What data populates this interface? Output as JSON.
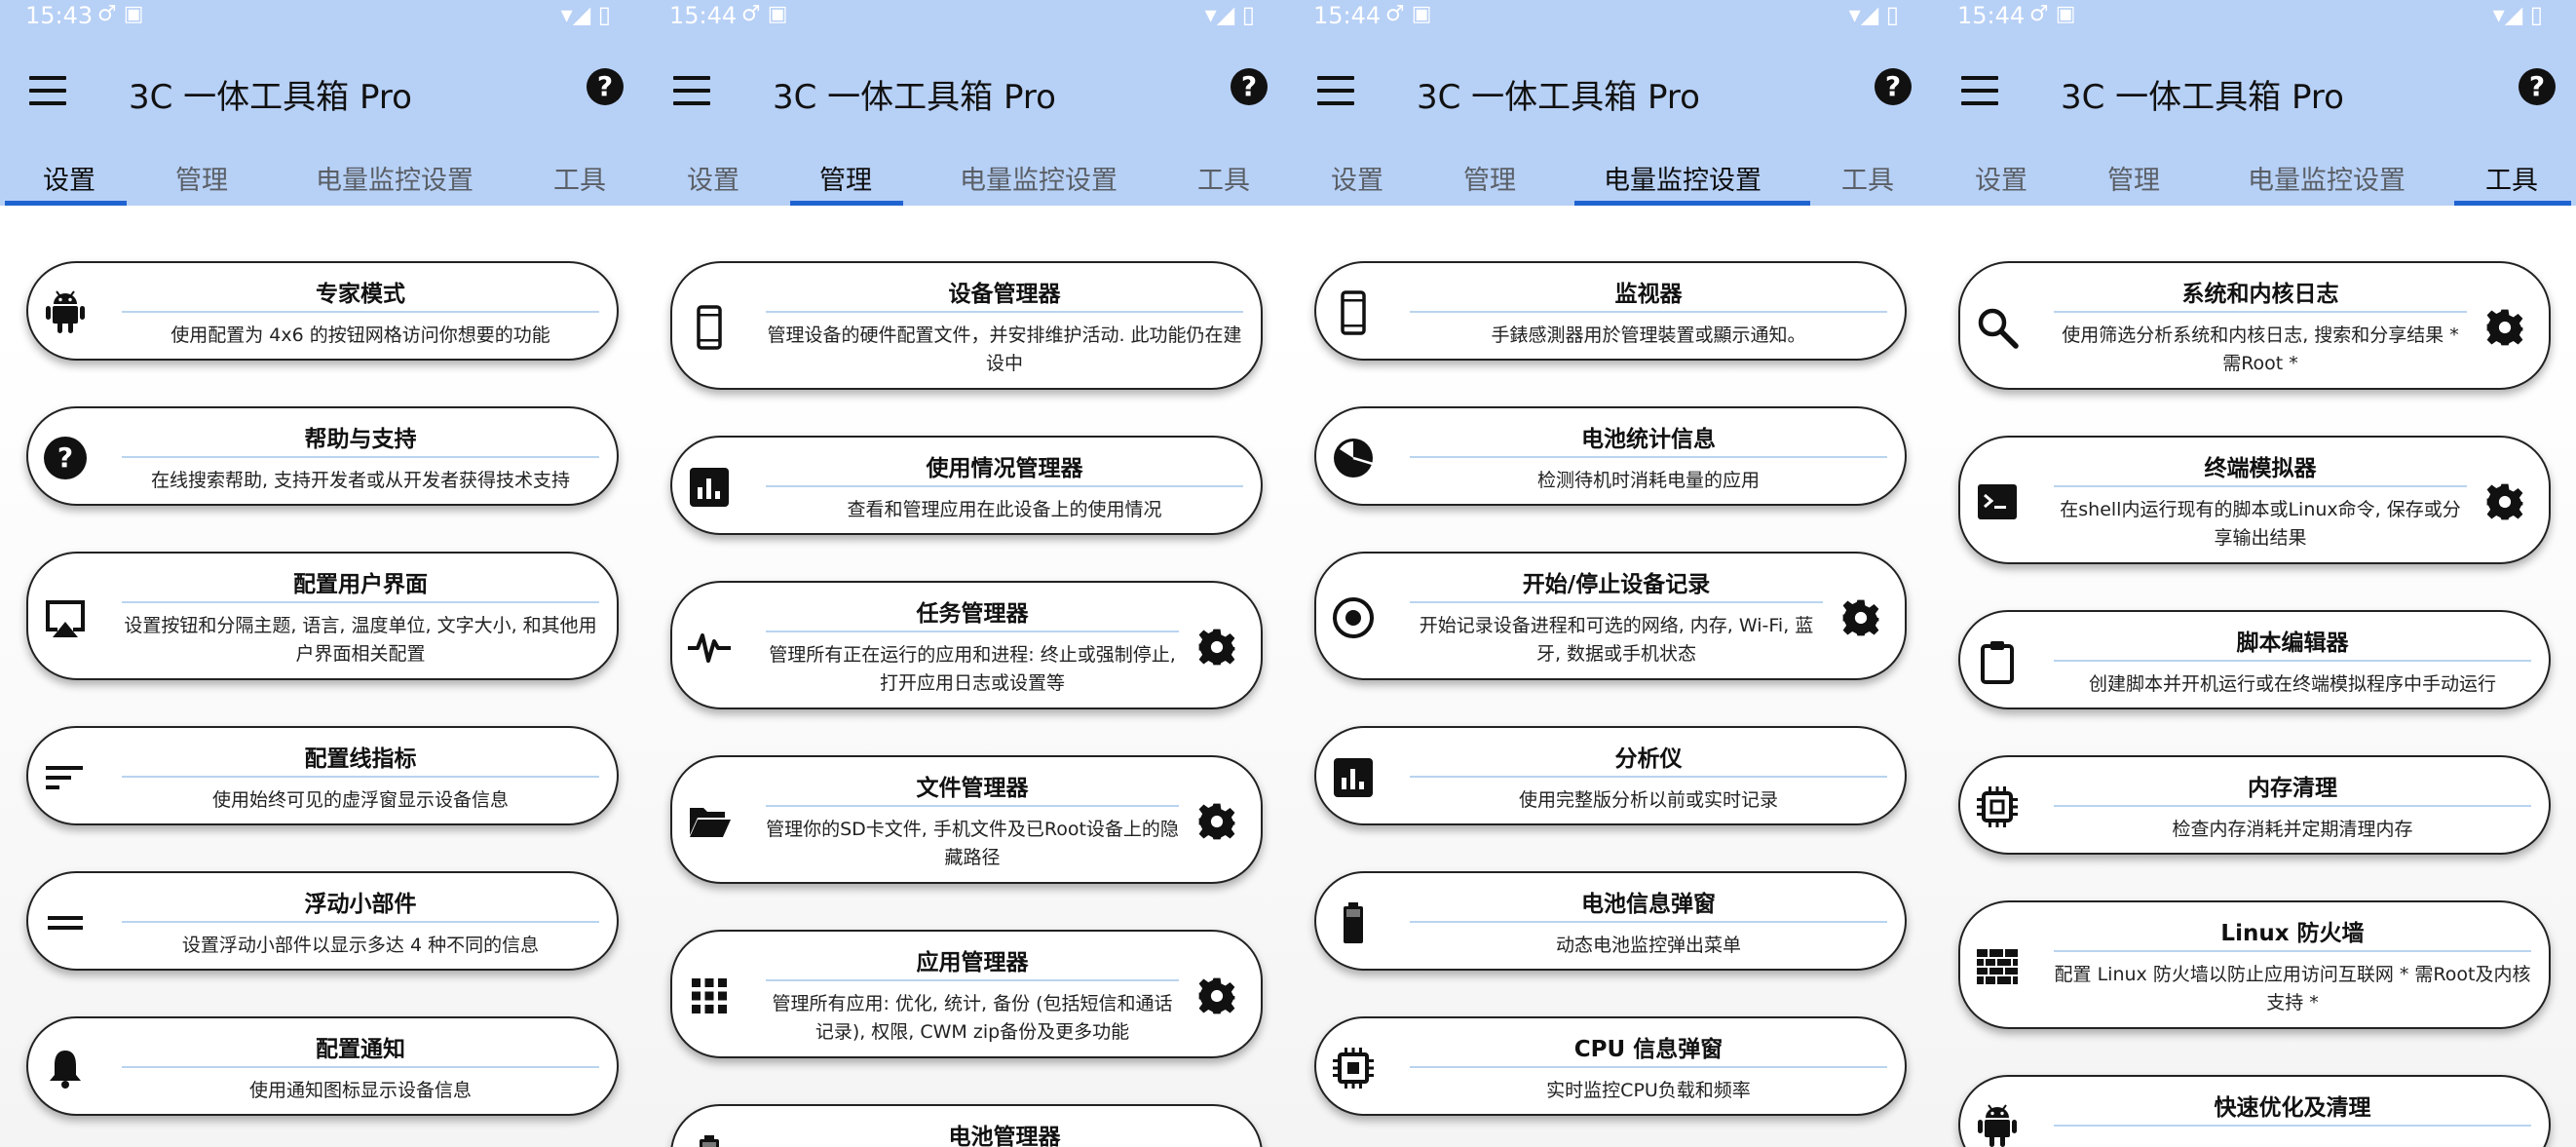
{
  "screens": [
    {
      "status": {
        "time": "15:43",
        "left_icons": "♂ ▣",
        "right_icons": "▾◢ ▯"
      },
      "title": "3C 一体工具箱 Pro",
      "tabs": [
        {
          "label": "设置"
        },
        {
          "label": "管理"
        },
        {
          "label": "电量监控设置"
        },
        {
          "label": "工具"
        }
      ],
      "active_tab": 0,
      "cards": [
        {
          "title": "专家模式",
          "desc": "使用配置为 4x6 的按钮网格访问你想要的功能",
          "icon": "android-icon",
          "gear": false
        },
        {
          "title": "帮助与支持",
          "desc": "在线搜索帮助, 支持开发者或从开发者获得技术支持",
          "icon": "help-circle-icon",
          "gear": false
        },
        {
          "title": "配置用户界面",
          "desc": "设置按钮和分隔主题, 语言, 温度单位, 文字大小, 和其他用户界面相关配置",
          "icon": "cast-screen-icon",
          "gear": false
        },
        {
          "title": "配置线指标",
          "desc": "使用始终可见的虚浮窗显示设备信息",
          "icon": "short-lines-icon",
          "gear": false
        },
        {
          "title": "浮动小部件",
          "desc": "设置浮动小部件以显示多达 4 种不同的信息",
          "icon": "equals-icon",
          "gear": false
        },
        {
          "title": "配置通知",
          "desc": "使用通知图标显示设备信息",
          "icon": "bell-icon",
          "gear": false
        }
      ]
    },
    {
      "status": {
        "time": "15:44",
        "left_icons": "♂ ▣",
        "right_icons": "▾◢ ▯"
      },
      "title": "3C 一体工具箱 Pro",
      "tabs": [
        {
          "label": "设置"
        },
        {
          "label": "管理"
        },
        {
          "label": "电量监控设置"
        },
        {
          "label": "工具"
        }
      ],
      "active_tab": 1,
      "cards": [
        {
          "title": "设备管理器",
          "desc": "管理设备的硬件配置文件，并安排维护活动. 此功能仍在建设中",
          "icon": "phone-icon",
          "gear": false
        },
        {
          "title": "使用情况管理器",
          "desc": "查看和管理应用在此设备上的使用情况",
          "icon": "bar-chart-icon",
          "gear": false
        },
        {
          "title": "任务管理器",
          "desc": "管理所有正在运行的应用和进程: 终止或强制停止, 打开应用日志或设置等",
          "icon": "pulse-icon",
          "gear": true
        },
        {
          "title": "文件管理器",
          "desc": "管理你的SD卡文件, 手机文件及已Root设备上的隐藏路径",
          "icon": "folder-open-icon",
          "gear": true
        },
        {
          "title": "应用管理器",
          "desc": "管理所有应用: 优化, 统计, 备份 (包括短信和通话记录), 权限, CWM zip备份及更多功能",
          "icon": "apps-grid-icon",
          "gear": true
        },
        {
          "title": "电池管理器",
          "desc": "",
          "icon": "battery-icon",
          "gear": false
        }
      ]
    },
    {
      "status": {
        "time": "15:44",
        "left_icons": "♂ ▣",
        "right_icons": "▾◢ ▯"
      },
      "title": "3C 一体工具箱 Pro",
      "tabs": [
        {
          "label": "设置"
        },
        {
          "label": "管理"
        },
        {
          "label": "电量监控设置"
        },
        {
          "label": "工具"
        }
      ],
      "active_tab": 2,
      "cards": [
        {
          "title": "监视器",
          "desc": "手錶感測器用於管理裝置或顯示通知。",
          "icon": "phone-icon",
          "gear": false
        },
        {
          "title": "电池统计信息",
          "desc": "检测待机时消耗电量的应用",
          "icon": "pie-chart-icon",
          "gear": false
        },
        {
          "title": "开始/停止设备记录",
          "desc": "开始记录设备进程和可选的网络, 内存, Wi-Fi, 蓝牙, 数据或手机状态",
          "icon": "record-icon",
          "gear": true
        },
        {
          "title": "分析仪",
          "desc": "使用完整版分析以前或实时记录",
          "icon": "bar-chart-icon",
          "gear": false
        },
        {
          "title": "电池信息弹窗",
          "desc": "动态电池监控弹出菜单",
          "icon": "battery-icon",
          "gear": false
        },
        {
          "title": "CPU 信息弹窗",
          "desc": "实时监控CPU负载和频率",
          "icon": "chip-icon",
          "gear": false
        }
      ]
    },
    {
      "status": {
        "time": "15:44",
        "left_icons": "♂ ▣",
        "right_icons": "▾◢ ▯"
      },
      "title": "3C 一体工具箱 Pro",
      "tabs": [
        {
          "label": "设置"
        },
        {
          "label": "管理"
        },
        {
          "label": "电量监控设置"
        },
        {
          "label": "工具"
        }
      ],
      "active_tab": 3,
      "cards": [
        {
          "title": "系统和内核日志",
          "desc": "使用筛选分析系统和内核日志, 搜索和分享结果 * 需Root *",
          "icon": "search-icon",
          "gear": true
        },
        {
          "title": "终端模拟器",
          "desc": "在shell内运行现有的脚本或Linux命令, 保存或分享输出结果",
          "icon": "terminal-icon",
          "gear": true
        },
        {
          "title": "脚本编辑器",
          "desc": "创建脚本并开机运行或在终端模拟程序中手动运行",
          "icon": "clipboard-icon",
          "gear": false
        },
        {
          "title": "内存清理",
          "desc": "检查内存消耗并定期清理内存",
          "icon": "memory-chip-icon",
          "gear": false
        },
        {
          "title": "Linux 防火墙",
          "desc": "配置 Linux 防火墙以防止应用访问互联网 * 需Root及内核支持 *",
          "icon": "firewall-icon",
          "gear": false
        },
        {
          "title": "快速优化及清理",
          "desc": "",
          "icon": "android-icon",
          "gear": false
        }
      ]
    }
  ]
}
